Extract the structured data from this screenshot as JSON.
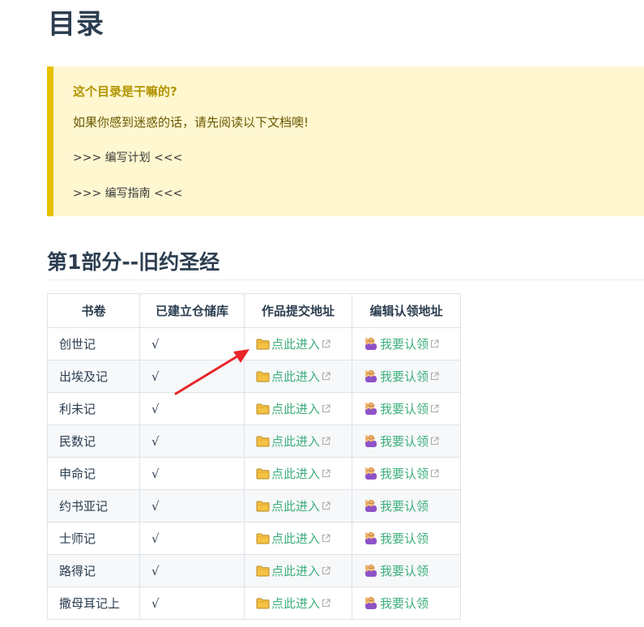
{
  "page": {
    "title": "目录"
  },
  "tip": {
    "title": "这个目录是干嘛的?",
    "line": "如果你感到迷惑的话，请先阅读以下文档噢!",
    "links": [
      ">>> 编写计划 <<<",
      ">>> 编写指南 <<<"
    ]
  },
  "section": {
    "title": "第1部分--旧约圣经"
  },
  "table": {
    "headers": [
      "书卷",
      "已建立仓储库",
      "作品提交地址",
      "编辑认领地址"
    ],
    "rows": [
      {
        "book": "创世记",
        "created": "√",
        "submit": "点此进入",
        "claim": "我要认领",
        "claim_ext": true
      },
      {
        "book": "出埃及记",
        "created": "√",
        "submit": "点此进入",
        "claim": "我要认领",
        "claim_ext": true
      },
      {
        "book": "利未记",
        "created": "√",
        "submit": "点此进入",
        "claim": "我要认领",
        "claim_ext": true
      },
      {
        "book": "民数记",
        "created": "√",
        "submit": "点此进入",
        "claim": "我要认领",
        "claim_ext": true
      },
      {
        "book": "申命记",
        "created": "√",
        "submit": "点此进入",
        "claim": "我要认领",
        "claim_ext": true
      },
      {
        "book": "约书亚记",
        "created": "√",
        "submit": "点此进入",
        "claim": "我要认领",
        "claim_ext": false
      },
      {
        "book": "士师记",
        "created": "√",
        "submit": "点此进入",
        "claim": "我要认领",
        "claim_ext": false
      },
      {
        "book": "路得记",
        "created": "√",
        "submit": "点此进入",
        "claim": "我要认领",
        "claim_ext": false
      },
      {
        "book": "撒母耳记上",
        "created": "√",
        "submit": "点此进入",
        "claim": "我要认领",
        "claim_ext": false
      }
    ]
  },
  "colors": {
    "link": "#3eaf7c",
    "tip_bg": "#fff7d0",
    "tip_border": "#e7c000",
    "annotation_arrow": "#e8262b"
  },
  "icons": {
    "submit": "folder-icon",
    "claim": "person-raising-hand-icon",
    "external": "external-link-icon"
  }
}
